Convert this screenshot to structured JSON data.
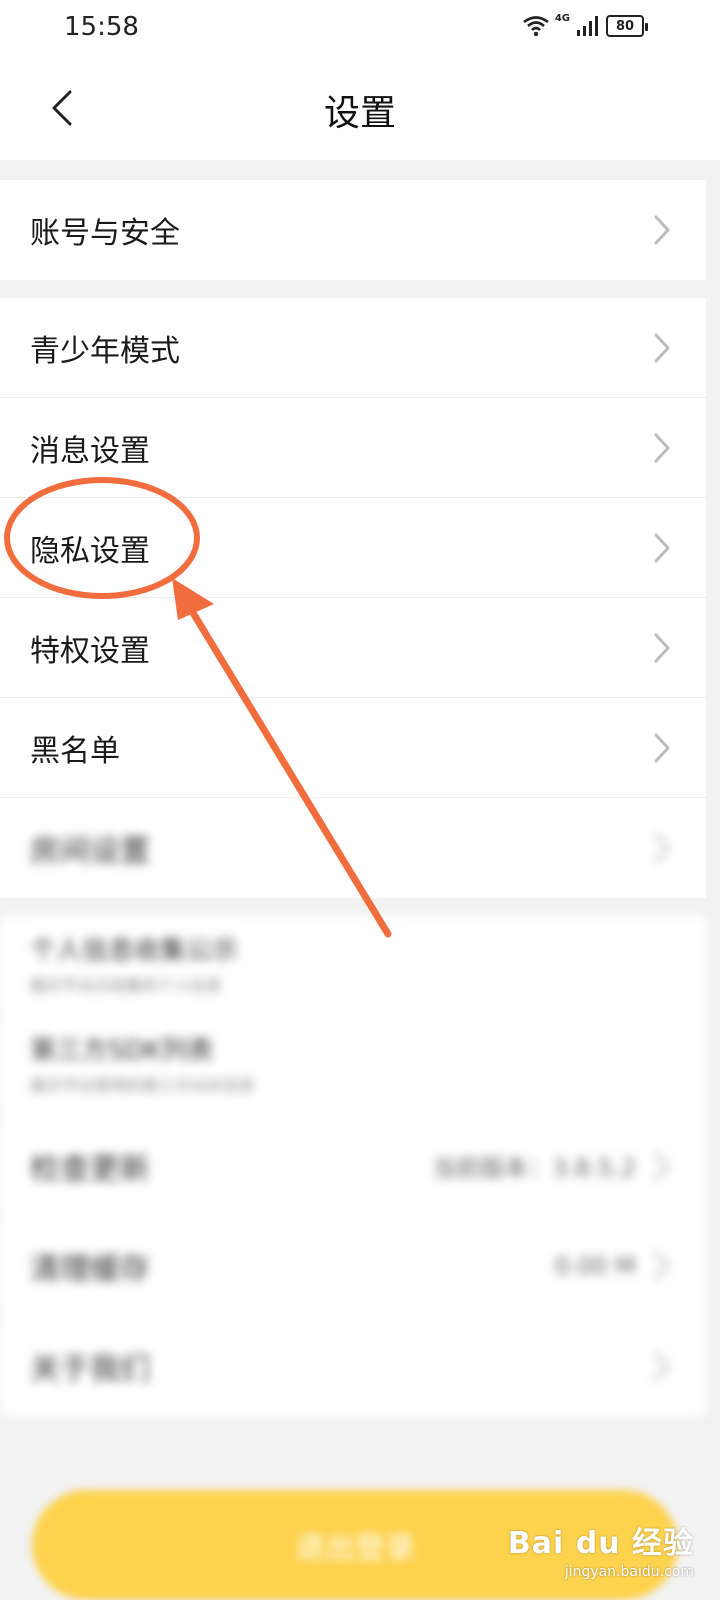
{
  "status_bar": {
    "time": "15:58",
    "network": "4G",
    "battery": "80"
  },
  "header": {
    "title": "设置",
    "back_icon": "chevron-left-icon"
  },
  "groups": [
    {
      "items": [
        {
          "label": "账号与安全"
        }
      ]
    },
    {
      "items": [
        {
          "label": "青少年模式"
        },
        {
          "label": "消息设置"
        },
        {
          "label": "隐私设置"
        },
        {
          "label": "特权设置"
        },
        {
          "label": "黑名单"
        },
        {
          "label": "房间设置"
        }
      ]
    },
    {
      "items": [
        {
          "label": "个人信息收集公示",
          "sub": "展示平台已收集的个人信息"
        },
        {
          "label": "第三方SDK列表",
          "sub": "展示平台使用的第三方SDK信息"
        },
        {
          "label": "检查更新",
          "value": "当前版本：3.8.5.2"
        },
        {
          "label": "清理缓存",
          "value": "0.00 M"
        },
        {
          "label": "关于我们"
        }
      ]
    }
  ],
  "logout_button": {
    "label": "退出登录",
    "color": "#fdd24d"
  },
  "annotation": {
    "color": "#f26d3d",
    "target": "隐私设置"
  },
  "watermark": {
    "logo": "Bai du 经验",
    "url": "jingyan.baidu.com"
  }
}
